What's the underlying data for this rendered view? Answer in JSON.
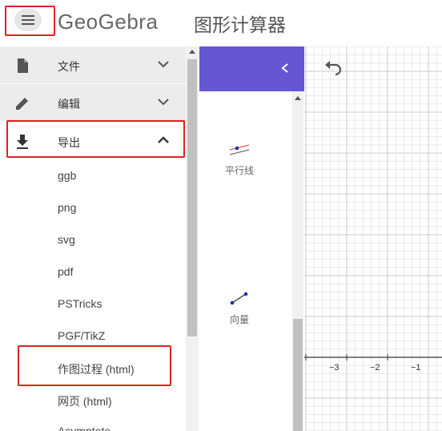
{
  "header": {
    "logo_text": "GeoGebra",
    "app_title": "图形计算器",
    "menu_icon": "hamburger-menu-icon"
  },
  "menu": {
    "items": [
      {
        "label": "文件",
        "icon": "file-icon",
        "expanded": false
      },
      {
        "label": "编辑",
        "icon": "pencil-edit-icon",
        "expanded": false
      },
      {
        "label": "导出",
        "icon": "download-icon",
        "expanded": true
      }
    ],
    "export_options": [
      "ggb",
      "png",
      "svg",
      "pdf",
      "PSTricks",
      "PGF/TikZ",
      "作图过程 (html)",
      "网页 (html)",
      "Asymptote"
    ]
  },
  "tools": {
    "back_icon": "chevron-left-icon",
    "items": [
      {
        "label": "平行线",
        "icon": "parallel-line-icon"
      },
      {
        "label": "向量",
        "icon": "vector-icon"
      }
    ]
  },
  "graphics": {
    "undo_icon": "undo-icon",
    "x_ticks": [
      "−3",
      "−2",
      "−1"
    ]
  },
  "colors": {
    "accent_purple": "#6557d2",
    "highlight_red": "#e32020",
    "axis": "#333333",
    "grid_major": "#c8c8c8",
    "grid_minor": "#e8e8e8"
  }
}
